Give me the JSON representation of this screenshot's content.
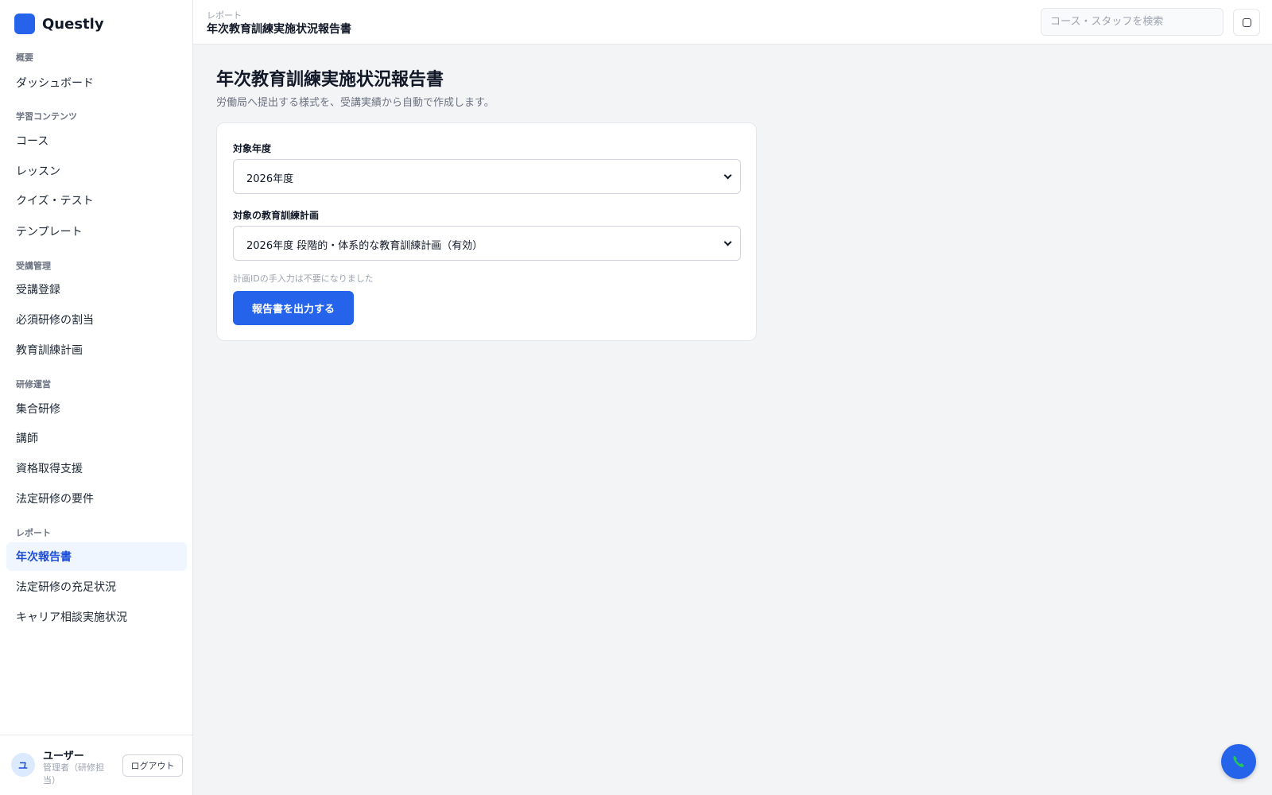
{
  "brand": {
    "name": "Questly"
  },
  "sidebar": {
    "sections": [
      {
        "label": "概要"
      },
      {
        "label": "学習コンテンツ"
      },
      {
        "label": "受講管理"
      },
      {
        "label": "研修運営"
      },
      {
        "label": "レポート"
      }
    ],
    "items": [
      {
        "label": "ダッシュボード"
      },
      {
        "label": "コース"
      },
      {
        "label": "レッスン"
      },
      {
        "label": "クイズ・テスト"
      },
      {
        "label": "テンプレート"
      },
      {
        "label": "受講登録"
      },
      {
        "label": "必須研修の割当"
      },
      {
        "label": "教育訓練計画"
      },
      {
        "label": "集合研修"
      },
      {
        "label": "講師"
      },
      {
        "label": "資格取得支援"
      },
      {
        "label": "法定研修の要件"
      },
      {
        "label": "年次報告書",
        "active": true
      },
      {
        "label": "法定研修の充足状況"
      },
      {
        "label": "キャリア相談実施状況"
      }
    ],
    "user": {
      "initial": "ユ",
      "name": "ユーザー",
      "role": "管理者（研修担当）",
      "logout_label": "ログアウト"
    }
  },
  "header": {
    "breadcrumb": "レポート",
    "title": "年次教育訓練実施状況報告書",
    "search_placeholder": "コース・スタッフを検索"
  },
  "main": {
    "title": "年次教育訓練実施状況報告書",
    "subtitle": "労働局へ提出する様式を、受講実績から自動で作成します。",
    "form": {
      "year_label": "対象年度",
      "year_value": "2026年度",
      "plan_label": "対象の教育訓練計画",
      "plan_value": "2026年度 段階的・体系的な教育訓練計画（有効）",
      "hint": "計画IDの手入力は不要になりました",
      "submit_label": "報告書を出力する"
    }
  },
  "colors": {
    "accent": "#2563eb",
    "active_bg": "#eff6ff",
    "fab_icon": "#22c55e"
  }
}
